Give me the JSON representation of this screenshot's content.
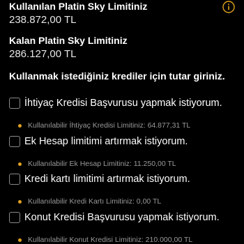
{
  "used_limit": {
    "title": "Kullanılan Platin Sky Limitiniz",
    "value": "238.872,00 TL"
  },
  "remaining_limit": {
    "title": "Kalan Platin Sky Limitiniz",
    "value": "286.127,00 TL"
  },
  "info_icon": "info-circle-icon",
  "section_heading": "Kullanmak istediğiniz krediler için tutar giriniz.",
  "options": [
    {
      "label": "İhtiyaç Kredisi Başvurusu yapmak istiyorum.",
      "available": "Kullanılabilir İhtiyaç Kredisi Limitiniz: 64.877,31 TL",
      "checked": false
    },
    {
      "label": "Ek Hesap limitimi artırmak istiyorum.",
      "available": "Kullanılabilir Ek Hesap Limitiniz: 11.250,00 TL",
      "checked": false
    },
    {
      "label": "Kredi kartı limitimi artırmak istiyorum.",
      "available": "Kullanılabilir Kredi Kartı Limitiniz: 0,00 TL",
      "checked": false
    },
    {
      "label": "Konut Kredisi Başvurusu yapmak istiyorum.",
      "available": "Kullanılabilir Konut Kredisi Limitiniz: 210.000,00 TL",
      "checked": false
    }
  ],
  "colors": {
    "background": "#000000",
    "accent": "#e0a21f",
    "muted_text": "#9a9a9a"
  }
}
